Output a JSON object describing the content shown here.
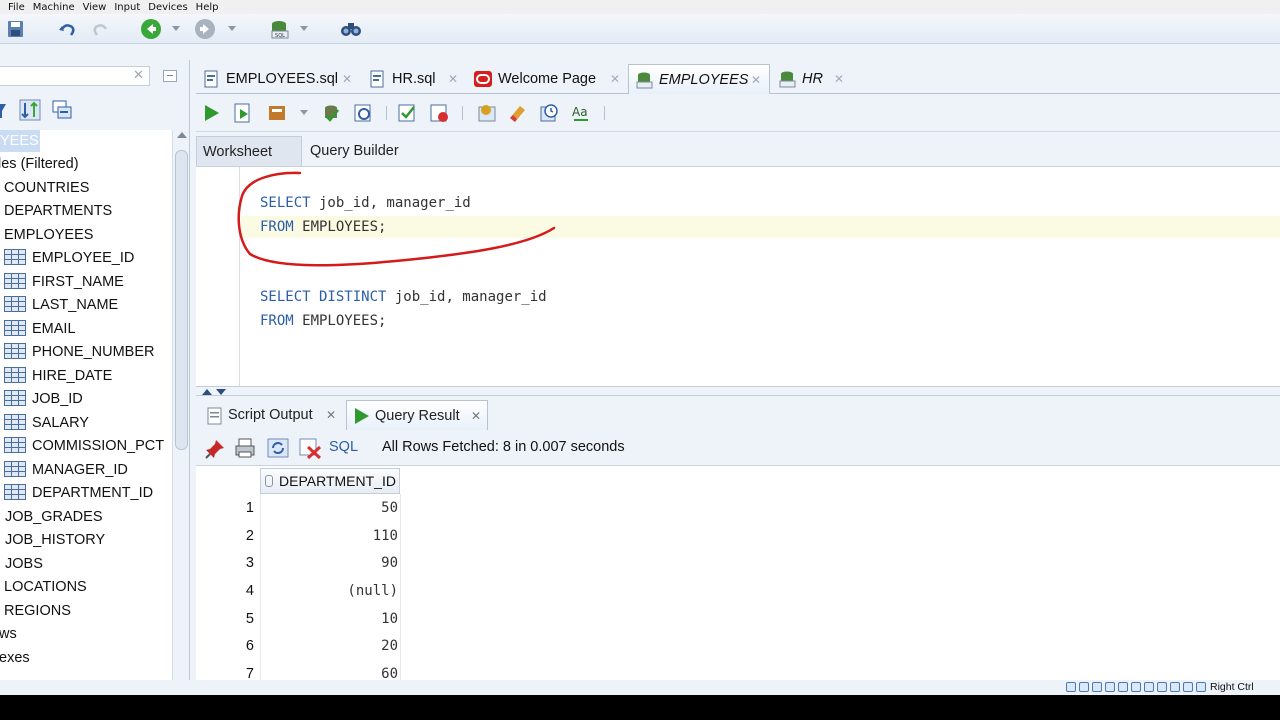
{
  "vm_menu": [
    "File",
    "Machine",
    "View",
    "Input",
    "Devices",
    "Help"
  ],
  "navigator": {
    "selected_partial": "YEES",
    "tables_partial": "les (Filtered)",
    "tables": [
      "COUNTRIES",
      "DEPARTMENTS",
      "EMPLOYEES"
    ],
    "columns": [
      "EMPLOYEE_ID",
      "FIRST_NAME",
      "LAST_NAME",
      "EMAIL",
      "PHONE_NUMBER",
      "HIRE_DATE",
      "JOB_ID",
      "SALARY",
      "COMMISSION_PCT",
      "MANAGER_ID",
      "DEPARTMENT_ID"
    ],
    "more_tables": [
      "JOB_GRADES",
      "JOB_HISTORY",
      "JOBS",
      "LOCATIONS",
      "REGIONS"
    ],
    "views_partial": "ws",
    "indexes_partial": "exes"
  },
  "doc_tabs": [
    {
      "label": "EMPLOYEES.sql"
    },
    {
      "label": "HR.sql"
    },
    {
      "label": "Welcome Page"
    },
    {
      "label": "EMPLOYEES"
    },
    {
      "label": "HR"
    }
  ],
  "sub_tabs": {
    "worksheet": "Worksheet",
    "query_builder": "Query Builder"
  },
  "code": {
    "line1_kw": "SELECT",
    "line1_rest": " job_id, manager_id",
    "line2_kw": "FROM",
    "line2_rest": " EMPLOYEES;",
    "line3_kw": "SELECT DISTINCT",
    "line3_rest": " job_id, manager_id",
    "line4_kw": "FROM",
    "line4_rest": " EMPLOYEES;"
  },
  "result_tabs": {
    "script_output": "Script Output",
    "query_result": "Query Result"
  },
  "result_toolbar": {
    "sql": "SQL",
    "status": "All Rows Fetched: 8 in 0.007 seconds"
  },
  "grid": {
    "column": "DEPARTMENT_ID",
    "rows": [
      {
        "n": "1",
        "v": "50"
      },
      {
        "n": "2",
        "v": "110"
      },
      {
        "n": "3",
        "v": "90"
      },
      {
        "n": "4",
        "v": "(null)"
      },
      {
        "n": "5",
        "v": "10"
      },
      {
        "n": "6",
        "v": "20"
      },
      {
        "n": "7",
        "v": "60"
      }
    ]
  },
  "vm_status": {
    "host_key": "Right Ctrl"
  },
  "colors": {
    "annotation": "#d41a1a",
    "keyword": "#2b5da8",
    "selection": "#c9dcf3"
  }
}
